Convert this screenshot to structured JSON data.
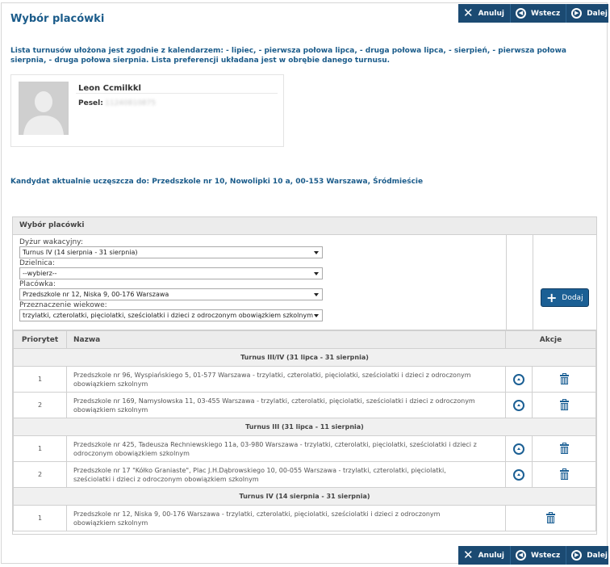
{
  "page": {
    "title": "Wybór placówki",
    "info": "Lista turnusów ułożona jest zgodnie z kalendarzem: - lipiec, - pierwsza połowa lipca, - druga połowa lipca, - sierpień, - pierwsza połowa sierpnia, - druga połowa sierpnia. Lista preferencji układana jest w obrębie danego turnusu.",
    "current_school": "Kandydat aktualnie uczęszcza do: Przedszkole nr 10, Nowolipki 10 a, 00-153 Warszawa, Śródmieście"
  },
  "toolbar": {
    "cancel": "Anuluj",
    "back": "Wstecz",
    "next": "Dalej"
  },
  "profile": {
    "name": "Leon Ccmilkkl",
    "pesel_label": "Pesel:",
    "pesel_value": "11240810875"
  },
  "form": {
    "section_title": "Wybór placówki",
    "dyzur_label": "Dyżur wakacyjny:",
    "dyzur_value": "Turnus IV (14 sierpnia - 31 sierpnia)",
    "dzielnica_label": "Dzielnica:",
    "dzielnica_value": "--wybierz--",
    "placowka_label": "Placówka:",
    "placowka_value": "Przedszkole nr 12, Niska 9, 00-176 Warszawa",
    "wiek_label": "Przeznaczenie wiekowe:",
    "wiek_value": "trzylatki, czterolatki, pięciolatki, sześciolatki i dzieci z odroczonym obowiązkiem szkolnym",
    "add_button": "Dodaj"
  },
  "table": {
    "col_priority": "Priorytet",
    "col_name": "Nazwa",
    "col_actions": "Akcje",
    "groups": [
      {
        "title": "Turnus III/IV (31 lipca - 31 sierpnia)",
        "rows": [
          {
            "priority": "1",
            "name": "Przedszkole nr 96, Wyspiańskiego 5, 01-577 Warszawa - trzylatki, czterolatki, pięciolatki, sześciolatki i dzieci z odroczonym obowiązkiem szkolnym"
          },
          {
            "priority": "2",
            "name": "Przedszkole nr 169, Namysłowska 11, 03-455 Warszawa - trzylatki, czterolatki, pięciolatki, sześciolatki i dzieci z odroczonym obowiązkiem szkolnym"
          }
        ]
      },
      {
        "title": "Turnus III (31 lipca - 11 sierpnia)",
        "rows": [
          {
            "priority": "1",
            "name": "Przedszkole nr 425, Tadeusza Rechniewskiego 11a, 03-980 Warszawa - trzylatki, czterolatki, pięciolatki, sześciolatki i dzieci z odroczonym obowiązkiem szkolnym"
          },
          {
            "priority": "2",
            "name": "Przedszkole nr 17 \"Kółko Graniaste\", Plac J.H.Dąbrowskiego 10, 00-055 Warszawa - trzylatki, czterolatki, pięciolatki, sześciolatki i dzieci z odroczonym obowiązkiem szkolnym"
          }
        ]
      },
      {
        "title": "Turnus IV (14 sierpnia - 31 sierpnia)",
        "rows": [
          {
            "priority": "1",
            "name": "Przedszkole nr 12, Niska 9, 00-176 Warszawa - trzylatki, czterolatki, pięciolatki, sześciolatki i dzieci z odroczonym obowiązkiem szkolnym"
          }
        ]
      }
    ]
  },
  "icons": {
    "cancel": "close-icon",
    "back": "arrow-left-circle-icon",
    "next": "arrow-right-circle-icon",
    "add": "plus-icon",
    "move_up": "arrow-up-circle-icon",
    "delete": "trash-icon"
  },
  "colors": {
    "accent": "#1a5b8a",
    "toolbar": "#1b4a72",
    "button": "#1b5f94"
  }
}
